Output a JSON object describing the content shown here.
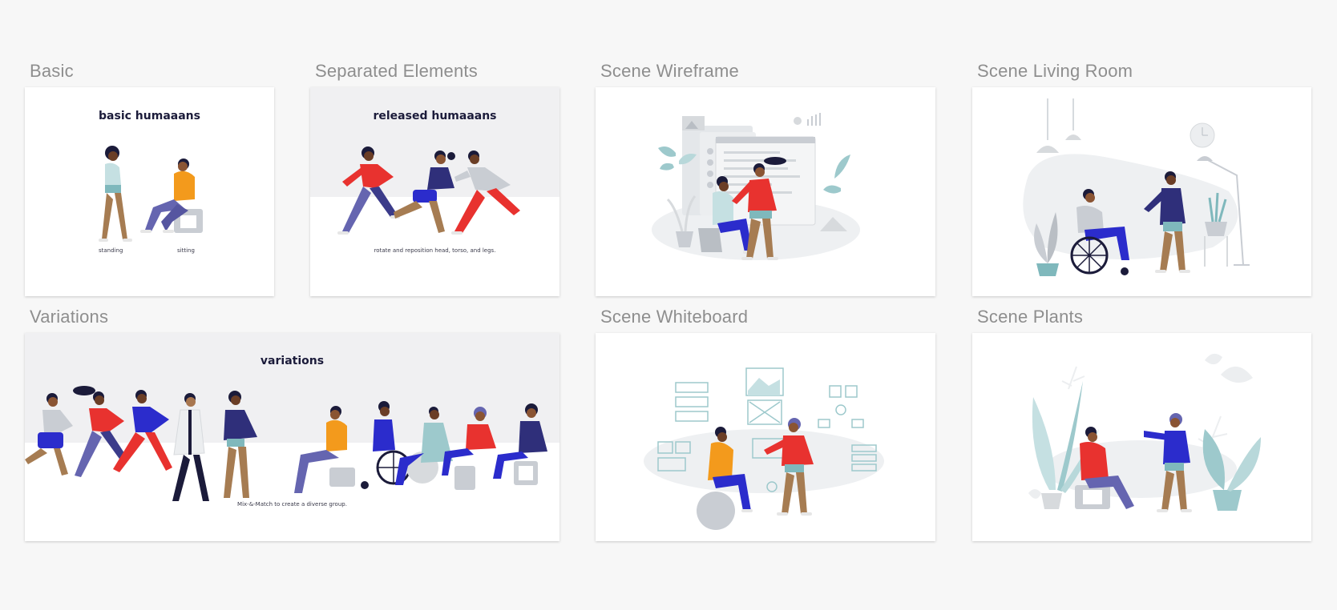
{
  "colors": {
    "background": "#f7f7f7",
    "label": "#8e8e8e",
    "ink": "#1b1b3a",
    "red": "#e8322f",
    "blue": "#2b2ccc",
    "orange": "#f39a1c",
    "teal": "#9dc9cc",
    "skin_dark": "#6b3e26",
    "skin_tan": "#a8764f",
    "pants": "#6565b0",
    "grey": "#c9cdd3"
  },
  "frames": [
    {
      "label": "Basic",
      "title": "basic humaaans",
      "captions": [
        "standing",
        "sitting"
      ]
    },
    {
      "label": "Separated Elements",
      "title": "released humaaans",
      "caption": "rotate and reposition head, torso, and legs."
    },
    {
      "label": "Scene Wireframe"
    },
    {
      "label": "Scene Living Room"
    },
    {
      "label": "Variations",
      "title": "variations",
      "caption": "Mix-&-Match to create a diverse group."
    },
    {
      "label": "Scene Whiteboard"
    },
    {
      "label": "Scene Plants"
    }
  ]
}
